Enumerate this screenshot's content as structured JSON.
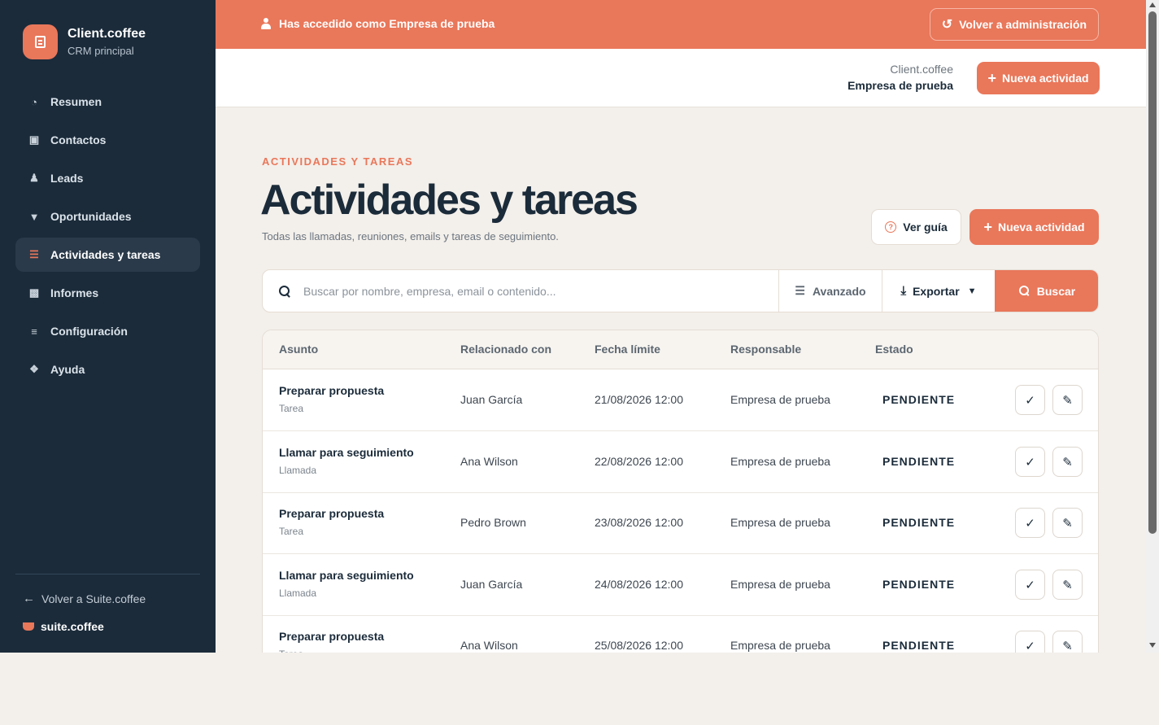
{
  "brand": {
    "name": "Client.coffee",
    "subtitle": "CRM principal"
  },
  "sidebar": {
    "items": [
      {
        "label": "Resumen",
        "icon": "pie-chart-icon"
      },
      {
        "label": "Contactos",
        "icon": "contact-card-icon"
      },
      {
        "label": "Leads",
        "icon": "user-plus-icon"
      },
      {
        "label": "Oportunidades",
        "icon": "funnel-icon"
      },
      {
        "label": "Actividades y tareas",
        "icon": "tasks-list-icon",
        "active": true
      },
      {
        "label": "Informes",
        "icon": "bar-chart-icon"
      },
      {
        "label": "Configuración",
        "icon": "sliders-icon"
      },
      {
        "label": "Ayuda",
        "icon": "lifebuoy-icon"
      }
    ],
    "back_label": "Volver a Suite.coffee",
    "suite_label": "suite.coffee"
  },
  "banner": {
    "text": "Has accedido como Empresa de prueba",
    "button": "Volver a administración"
  },
  "header": {
    "app_name": "Client.coffee",
    "company": "Empresa de prueba",
    "new_button": "Nueva actividad"
  },
  "page": {
    "eyebrow": "ACTIVIDADES Y TAREAS",
    "title": "Actividades y tareas",
    "subtitle": "Todas las llamadas, reuniones, emails y tareas de seguimiento.",
    "guide_button": "Ver guía",
    "new_button": "Nueva actividad"
  },
  "search": {
    "placeholder": "Buscar por nombre, empresa, email o contenido...",
    "advanced": "Avanzado",
    "export": "Exportar",
    "submit": "Buscar"
  },
  "table": {
    "headers": [
      "Asunto",
      "Relacionado con",
      "Fecha límite",
      "Responsable",
      "Estado"
    ],
    "rows": [
      {
        "subject": "Preparar propuesta",
        "type": "Tarea",
        "related": "Juan García",
        "due": "21/08/2026 12:00",
        "owner": "Empresa de prueba",
        "status": "PENDIENTE"
      },
      {
        "subject": "Llamar para seguimiento",
        "type": "Llamada",
        "related": "Ana Wilson",
        "due": "22/08/2026 12:00",
        "owner": "Empresa de prueba",
        "status": "PENDIENTE"
      },
      {
        "subject": "Preparar propuesta",
        "type": "Tarea",
        "related": "Pedro Brown",
        "due": "23/08/2026 12:00",
        "owner": "Empresa de prueba",
        "status": "PENDIENTE"
      },
      {
        "subject": "Llamar para seguimiento",
        "type": "Llamada",
        "related": "Juan García",
        "due": "24/08/2026 12:00",
        "owner": "Empresa de prueba",
        "status": "PENDIENTE"
      },
      {
        "subject": "Preparar propuesta",
        "type": "Tarea",
        "related": "Ana Wilson",
        "due": "25/08/2026 12:00",
        "owner": "Empresa de prueba",
        "status": "PENDIENTE"
      }
    ]
  },
  "colors": {
    "accent": "#e9775a",
    "sidebar": "#1b2b3a",
    "background": "#f3efea"
  }
}
